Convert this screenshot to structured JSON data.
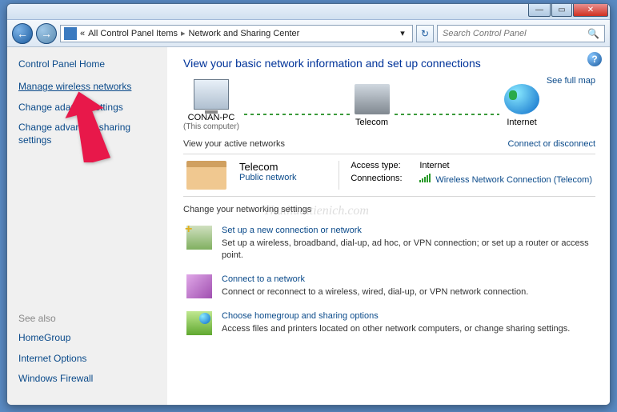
{
  "titlebar": {
    "min": "—",
    "max": "▭",
    "close": "✕"
  },
  "nav": {
    "crumb_prefix": "«",
    "crumb1": "All Control Panel Items",
    "crumb2": "Network and Sharing Center",
    "search_placeholder": "Search Control Panel"
  },
  "sidebar": {
    "home": "Control Panel Home",
    "links": [
      "Manage wireless networks",
      "Change adapter settings",
      "Change advanced sharing settings"
    ],
    "seealso_hdr": "See also",
    "seealso": [
      "HomeGroup",
      "Internet Options",
      "Windows Firewall"
    ]
  },
  "content": {
    "heading": "View your basic network information and set up connections",
    "map": {
      "node1": "CONAN-PC",
      "node1_sub": "(This computer)",
      "node2": "Telecom",
      "node3": "Internet",
      "fullmap": "See full map"
    },
    "active_hdr": "View your active networks",
    "active_link": "Connect or disconnect",
    "network": {
      "name": "Telecom",
      "type": "Public network",
      "access_lbl": "Access type:",
      "access_val": "Internet",
      "conn_lbl": "Connections:",
      "conn_val": "Wireless Network Connection (Telecom)"
    },
    "change_hdr": "Change your networking settings",
    "items": [
      {
        "title": "Set up a new connection or network",
        "desc": "Set up a wireless, broadband, dial-up, ad hoc, or VPN connection; or set up a router or access point."
      },
      {
        "title": "Connect to a network",
        "desc": "Connect or reconnect to a wireless, wired, dial-up, or VPN network connection."
      },
      {
        "title": "Choose homegroup and sharing options",
        "desc": "Access files and printers located on other network computers, or change sharing settings."
      }
    ]
  },
  "watermark": "Thuthuattienich.com"
}
